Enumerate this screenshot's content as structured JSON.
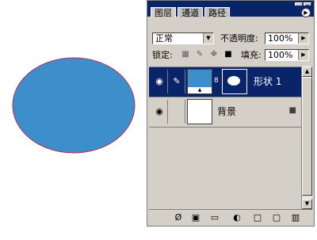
{
  "canvas": {
    "shape_fill": "#3d8fcb",
    "shape_stroke": "#b0305a"
  },
  "panel": {
    "tabs": [
      {
        "label": "图层"
      },
      {
        "label": "通道"
      },
      {
        "label": "路径"
      }
    ],
    "window_buttons": [
      "_",
      "×"
    ],
    "menu_button": "▶",
    "blend_mode": "正常",
    "opacity_label": "不透明度:",
    "opacity_value": "100%",
    "lock_label": "锁定:",
    "lock_icons": [
      "transparency-lock-icon",
      "brush-lock-icon",
      "move-lock-icon",
      "padlock-icon"
    ],
    "fill_label": "填充:",
    "fill_value": "100%",
    "layers": [
      {
        "name": "形状 1",
        "selected": true,
        "thumb_color": "#3d8fcb"
      },
      {
        "name": "背景",
        "selected": false,
        "thumb_color": "#ffffff"
      }
    ],
    "bottom_icons": [
      "link-layers-icon",
      "layer-style-icon",
      "mask-icon",
      "new-group-icon",
      "adjustment-layer-icon",
      "new-layer-icon",
      "trash-icon"
    ],
    "selection_color": "#0a246a"
  }
}
